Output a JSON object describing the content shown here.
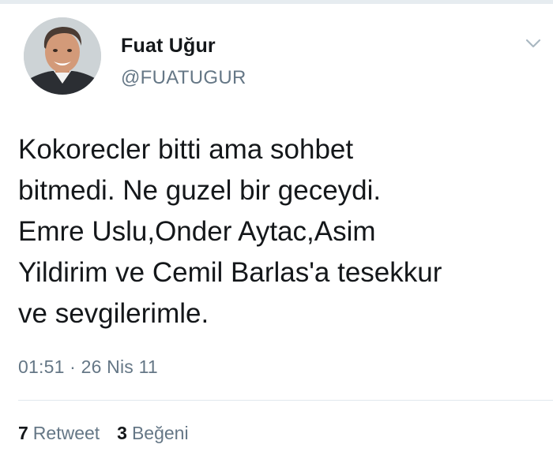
{
  "tweet": {
    "author": {
      "name": "Fuat Uğur",
      "handle": "@FUATUGUR"
    },
    "text": "Kokorecler bitti ama sohbet\nbitmedi. Ne guzel bir geceydi.\nEmre Uslu,Onder Aytac,Asim\nYildirim ve Cemil Barlas'a tesekkur\nve sevgilerimle.",
    "timestamp": "01:51 · 26 Nis 11",
    "stats": {
      "retweet_count": "7",
      "retweet_label": "Retweet",
      "like_count": "3",
      "like_label": "Beğeni"
    }
  },
  "icons": {
    "menu": "chevron-down-icon"
  },
  "colors": {
    "primary_text": "#14171a",
    "secondary_text": "#657786",
    "divider": "#e1e8ed"
  }
}
